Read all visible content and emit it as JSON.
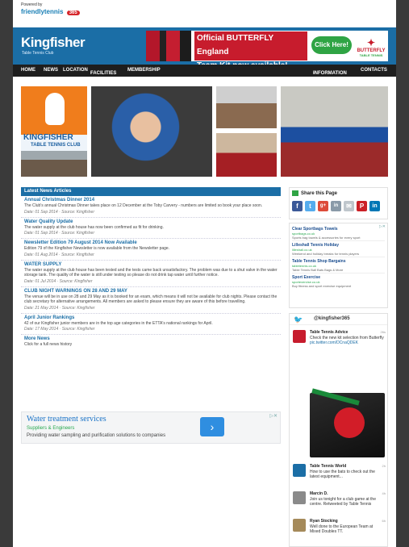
{
  "topbar": {
    "powered": "Powered by",
    "brand": "friendlytennis",
    "count": "365"
  },
  "header": {
    "title": "Kingfisher",
    "subtitle": "Table Tennis Club"
  },
  "ad_banner": {
    "line1": "Official BUTTERFLY England",
    "line2": "Team Kit now available!",
    "cta": "Click Here!",
    "brand": "BUTTERFLY",
    "brand_sub": "TABLE TENNIS"
  },
  "nav": {
    "items": [
      "HOME",
      "NEWS",
      "LOCATION",
      "FACILITIES",
      "MEMBERSHIP"
    ],
    "right": [
      "INFORMATION",
      "CONTACTS"
    ],
    "dropdown_suffix": " -"
  },
  "logo": {
    "name": "KINGFISHER",
    "sub": "TABLE TENNIS CLUB"
  },
  "news": {
    "header": "Latest News Articles",
    "articles": [
      {
        "title": "Annual Christmas Dinner 2014",
        "body": "The Club's annual Christmas Dinner takes place on 12 December at the Toby Carvery - numbers are limited so book your place soon.",
        "date": "Date: 01 Sep 2014 · Source: Kingfisher"
      },
      {
        "title": "Water Quality Update",
        "body": "The water supply at the club house has now been confirmed as fit for drinking.",
        "date": "Date: 01 Sep 2014 · Source: Kingfisher"
      },
      {
        "title": "Newsletter Edition 79 August 2014 Now Available",
        "body": "Edition 79 of the Kingfisher Newsletter is now available from the Newsletter page.",
        "date": "Date: 01 Aug 2014 · Source: Kingfisher"
      },
      {
        "title": "WATER SUPPLY",
        "body": "The water supply at the club house has been tested and the tests came back unsatisfactory. The problem was due to a shut valve in the water storage tank. The quality of the water is still under testing so please do not drink tap water until further notice.",
        "date": "Date: 01 Jul 2014 · Source: Kingfisher"
      },
      {
        "title": "CLUB NIGHT WARNINGS ON 28 AND 29 MAY",
        "body": "The venue will be in use on 28 and 29 May as it is booked for an exam, which means it will not be available for club nights. Please contact the club secretary for alternative arrangements. All members are asked to please ensure they are aware of this before travelling.",
        "date": "Date: 21 May 2014 · Source: Kingfisher"
      },
      {
        "title": "April Junior Rankings",
        "body": "42 of our Kingfisher junior members are in the top age categories in the ETTA's national rankings for April.",
        "date": "Date: 17 May 2014 · Source: Kingfisher"
      }
    ],
    "more_title": "More News",
    "more_text": "Click for a full news history"
  },
  "google_ad": {
    "headline": "Water treatment services",
    "url": "Suppliers & Engineers",
    "desc": "Providing water sampling and purification solutions to companies",
    "close": "▷✕"
  },
  "share": {
    "header": "Share this Page",
    "icons": [
      "f",
      "t",
      "g+",
      "in",
      "✉",
      "P",
      "in"
    ]
  },
  "side_ads": {
    "close": "▷✕",
    "items": [
      {
        "h": "Clear Sportbags Towels",
        "u": "sportbags.co.uk",
        "s": "Sports bag towels & accessories for every sport"
      },
      {
        "h": "Lilleshall Tennis Holiday",
        "u": "lilleshall.co.uk",
        "s": "Weekend and holiday breaks for tennis players"
      },
      {
        "h": "Table Tennis Shop Bargains",
        "u": "tabletennis.co.uk",
        "s": "Table Tennis Ball Bats Bags & More"
      },
      {
        "h": "Sport Exercise",
        "u": "sportexercise.co.uk",
        "s": "Buy fitness and sport exercise equipment"
      }
    ]
  },
  "twitter": {
    "handle": "@kingfisher365",
    "tweets": [
      {
        "name": "Table Tennis Advice",
        "text": "Check the new kit selection from Butterfly",
        "link": "pic.twitter.com/DCnaQDEK",
        "time": "26s"
      },
      {
        "name": "Table Tennis World",
        "text": "How to use the bats to check out the latest equipment...",
        "link": "",
        "time": "2h"
      },
      {
        "name": "Marcin D.",
        "text": "Join us tonight for a club game at the centre. Retweeted by Table Tennis",
        "link": "",
        "time": "4h"
      },
      {
        "name": "Ryan Stocking",
        "text": "Well done to the European Team at Mixed Doubles TT.",
        "link": "",
        "time": "6h"
      }
    ]
  },
  "colors": {
    "primary": "#1b6ea6",
    "nav": "#1e1e1e",
    "accent": "#f07d1c",
    "ad_red": "#c71c2d",
    "cta_green": "#2fa444"
  }
}
